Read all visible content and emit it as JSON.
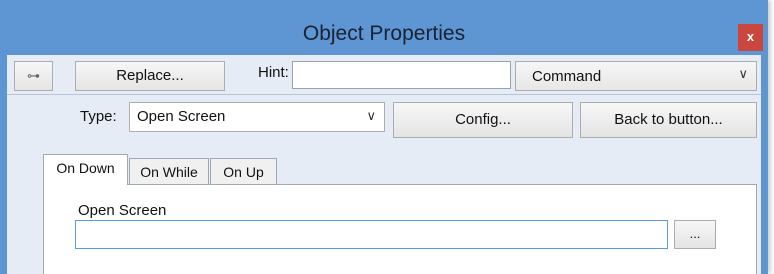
{
  "window": {
    "title": "Object Properties",
    "close_label": "x"
  },
  "toolbar": {
    "pin_icon": "pin-icon",
    "pin_label": "⊶",
    "replace_label": "Replace...",
    "hint_label": "Hint:",
    "hint_value": "",
    "command_value": "Command",
    "chevron": "∨"
  },
  "type_row": {
    "label": "Type:",
    "value": "Open Screen",
    "chevron": "∨",
    "config_label": "Config...",
    "back_label": "Back to button..."
  },
  "tabs": [
    {
      "label": "On Down",
      "active": true
    },
    {
      "label": "On While",
      "active": false
    },
    {
      "label": "On Up",
      "active": false
    }
  ],
  "panel": {
    "field_label": "Open Screen",
    "field_value": "",
    "browse_label": "..."
  },
  "colors": {
    "titlebar": "#5e95d3",
    "close": "#c9473f",
    "focus": "#569de5"
  }
}
